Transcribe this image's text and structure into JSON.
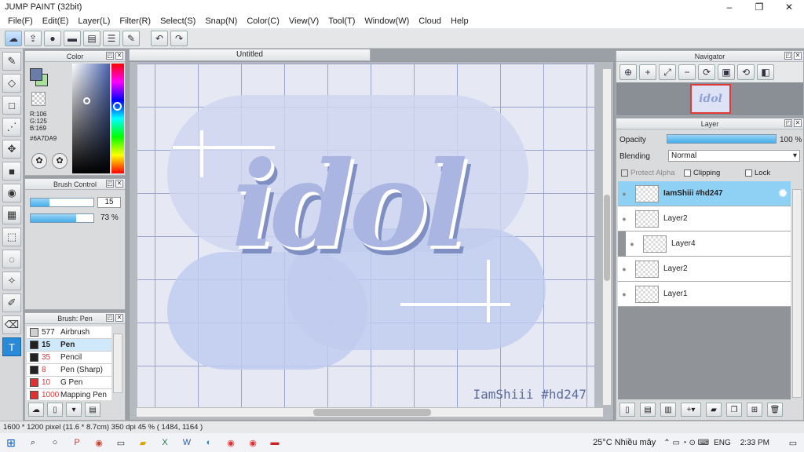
{
  "app": {
    "title": "JUMP PAINT (32bit)",
    "minimize": "–",
    "maximize": "❐",
    "close": "✕"
  },
  "menu": [
    "File(F)",
    "Edit(E)",
    "Layer(L)",
    "Filter(R)",
    "Select(S)",
    "Snap(N)",
    "Color(C)",
    "View(V)",
    "Tool(T)",
    "Window(W)",
    "Cloud",
    "Help"
  ],
  "color_panel": {
    "title": "Color",
    "r": "R:106",
    "g": "G:125",
    "b": "B:169",
    "hex": "#6A7DA9",
    "current_color": "#6a7da9"
  },
  "brush_control": {
    "title": "Brush Control",
    "size": "15",
    "opacity": "73 %",
    "size_fraction": 0.3,
    "opacity_fraction": 0.73
  },
  "brush_list": {
    "title": "Brush: Pen",
    "items": [
      {
        "size": "577",
        "name": "Airbrush",
        "swatch": "#d0d0d0"
      },
      {
        "size": "15",
        "name": "Pen",
        "swatch": "#222222"
      },
      {
        "size": "35",
        "name": "Pencil",
        "swatch": "#222222"
      },
      {
        "size": "8",
        "name": "Pen (Sharp)",
        "swatch": "#222222"
      },
      {
        "size": "10",
        "name": "G Pen",
        "swatch": "#e03030"
      },
      {
        "size": "1000",
        "name": "Mapping Pen",
        "swatch": "#e03030"
      }
    ]
  },
  "canvas": {
    "tab": "Untitled",
    "artwork_text": "idol",
    "watermark": "IamShiii #hd247"
  },
  "navigator": {
    "title": "Navigator",
    "thumb_text": "idol"
  },
  "layer_panel": {
    "title": "Layer",
    "opacity_label": "Opacity",
    "opacity_value": "100 %",
    "opacity_fraction": 1.0,
    "blending_label": "Blending",
    "blending_value": "Normal",
    "protect_alpha": "Protect Alpha",
    "clipping": "Clipping",
    "lock": "Lock",
    "layers": [
      {
        "name": "IamShiii #hd247",
        "selected": true
      },
      {
        "name": "Layer2",
        "selected": false
      },
      {
        "name": "Layer4",
        "selected": false
      },
      {
        "name": "Layer2",
        "selected": false
      },
      {
        "name": "Layer1",
        "selected": false
      }
    ]
  },
  "status": {
    "text": "1600 * 1200 pixel  (11.6 * 8.7cm)  350 dpi  45 %  ( 1484, 1164 )"
  },
  "taskbar": {
    "weather": "25°C  Nhiều mây",
    "lang": "ENG",
    "time": "2:33 PM"
  }
}
